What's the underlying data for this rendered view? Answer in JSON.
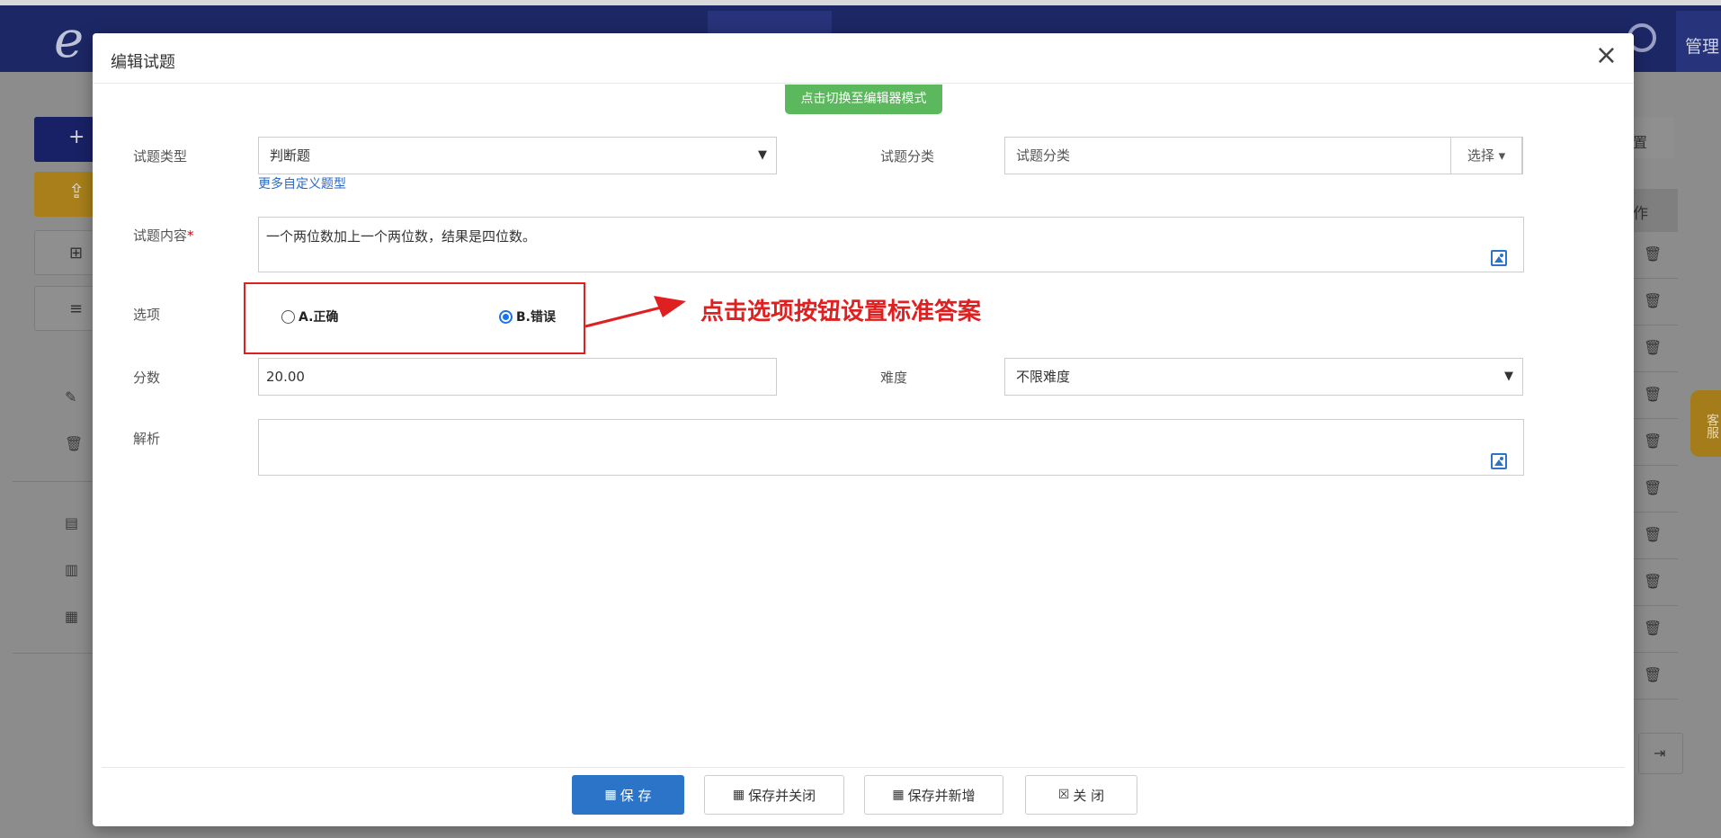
{
  "background": {
    "manage_label": "管理",
    "service_label": "客服",
    "table_header_partial": "作",
    "right_button_partial": "置"
  },
  "modal": {
    "title": "编辑试题",
    "close_glyph": "×",
    "switch_mode_label": "点击切换至编辑器模式",
    "question_type": {
      "label": "试题类型",
      "value": "判断题",
      "more_link": "更多自定义题型"
    },
    "question_category": {
      "label": "试题分类",
      "placeholder": "试题分类",
      "select_button": "选择 ▾"
    },
    "question_content": {
      "label": "试题内容",
      "required_mark": "*",
      "value": "一个两位数加上一个两位数，结果是四位数。"
    },
    "options": {
      "label": "选项",
      "items": [
        {
          "label": "A.正确",
          "checked": false
        },
        {
          "label": "B.错误",
          "checked": true
        }
      ]
    },
    "annotation": "点击选项按钮设置标准答案",
    "score": {
      "label": "分数",
      "value": "20.00"
    },
    "difficulty": {
      "label": "难度",
      "value": "不限难度"
    },
    "analysis": {
      "label": "解析",
      "value": ""
    },
    "footer": {
      "save": "保 存",
      "save_close": "保存并关闭",
      "save_new": "保存并新增",
      "close": "关 闭"
    }
  },
  "colors": {
    "primary": "#2b74c7",
    "success": "#5cb85c",
    "annotation_red": "#e02020"
  }
}
